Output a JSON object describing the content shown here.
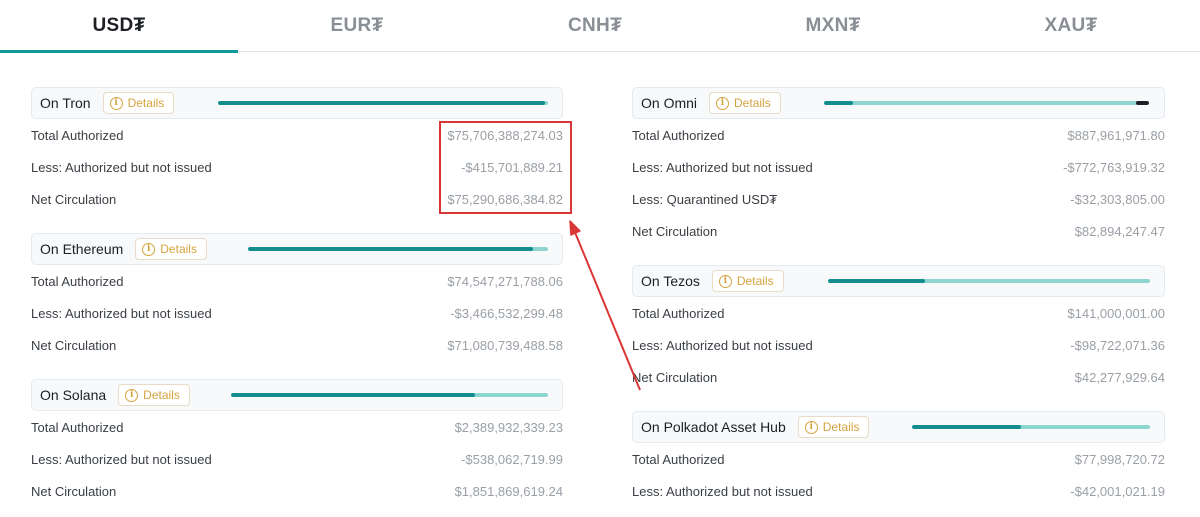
{
  "tabs": [
    "USD₮",
    "EUR₮",
    "CNH₮",
    "MXN₮",
    "XAU₮"
  ],
  "details_label": "Details",
  "colors": {
    "accent": "#129a9a",
    "bar_fill": "#148d8d",
    "bar_track": "#8dd5cf",
    "details": "#d5a33e",
    "annotation": "#d93737"
  },
  "left": [
    {
      "name": "On Tron",
      "issued_fraction": 0.99,
      "rows": [
        {
          "label": "Total Authorized",
          "value": "$75,706,388,274.03"
        },
        {
          "label": "Less: Authorized but not issued",
          "value": "-$415,701,889.21"
        },
        {
          "label": "Net Circulation",
          "value": "$75,290,686,384.82"
        }
      ]
    },
    {
      "name": "On Ethereum",
      "issued_fraction": 0.95,
      "rows": [
        {
          "label": "Total Authorized",
          "value": "$74,547,271,788.06"
        },
        {
          "label": "Less: Authorized but not issued",
          "value": "-$3,466,532,299.48"
        },
        {
          "label": "Net Circulation",
          "value": "$71,080,739,488.58"
        }
      ]
    },
    {
      "name": "On Solana",
      "issued_fraction": 0.77,
      "rows": [
        {
          "label": "Total Authorized",
          "value": "$2,389,932,339.23"
        },
        {
          "label": "Less: Authorized but not issued",
          "value": "-$538,062,719.99"
        },
        {
          "label": "Net Circulation",
          "value": "$1,851,869,619.24"
        }
      ]
    }
  ],
  "right": [
    {
      "name": "On Omni",
      "issued_fraction": 0.09,
      "quarantined_fraction": 0.04,
      "rows": [
        {
          "label": "Total Authorized",
          "value": "$887,961,971.80"
        },
        {
          "label": "Less: Authorized but not issued",
          "value": "-$772,763,919.32"
        },
        {
          "label": "Less: Quarantined USD₮",
          "value": "-$32,303,805.00"
        },
        {
          "label": "Net Circulation",
          "value": "$82,894,247.47"
        }
      ]
    },
    {
      "name": "On Tezos",
      "issued_fraction": 0.3,
      "rows": [
        {
          "label": "Total Authorized",
          "value": "$141,000,001.00"
        },
        {
          "label": "Less: Authorized but not issued",
          "value": "-$98,722,071.36"
        },
        {
          "label": "Net Circulation",
          "value": "$42,277,929.64"
        }
      ]
    },
    {
      "name": "On Polkadot Asset Hub",
      "issued_fraction": 0.46,
      "rows": [
        {
          "label": "Total Authorized",
          "value": "$77,998,720.72"
        },
        {
          "label": "Less: Authorized but not issued",
          "value": "-$42,001,021.19"
        }
      ]
    }
  ]
}
